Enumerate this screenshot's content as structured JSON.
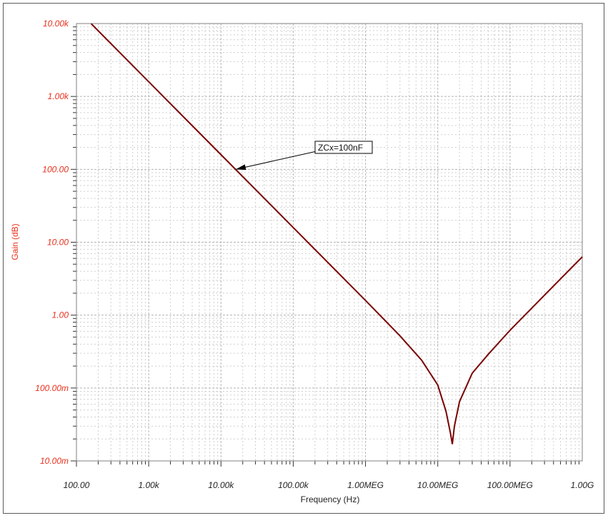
{
  "chart_data": {
    "type": "line",
    "xlabel": "Frequency (Hz)",
    "ylabel": "Gain (dB)",
    "x_scale": "log",
    "y_scale": "log",
    "xlim": [
      100,
      1000000000
    ],
    "ylim": [
      0.01,
      10000
    ],
    "grid": true,
    "x_tick_values": [
      100,
      1000,
      10000,
      100000,
      1000000,
      10000000,
      100000000,
      1000000000
    ],
    "x_tick_labels": [
      "100.00",
      "1.00k",
      "10.00k",
      "100.00k",
      "1.00MEG",
      "10.00MEG",
      "100.00MEG",
      "1.00G"
    ],
    "y_tick_values": [
      10000,
      1000,
      100,
      10,
      1,
      0.1,
      0.01
    ],
    "y_tick_labels": [
      "10.00k",
      "1.00k",
      "100.00",
      "10.00",
      "1.00",
      "100.00m",
      "10.00m"
    ],
    "series": [
      {
        "name": "ZCx=100nF",
        "color": "#7a0000",
        "x": [
          160,
          1000,
          10000,
          100000,
          1000000,
          3000000,
          6000000,
          10000000,
          13000000,
          15000000,
          15900000,
          17000000,
          20000000,
          30000000,
          50000000,
          100000000,
          300000000,
          1000000000
        ],
        "y": [
          9950,
          1590,
          159,
          15.9,
          1.59,
          0.52,
          0.24,
          0.11,
          0.048,
          0.024,
          0.017,
          0.03,
          0.065,
          0.16,
          0.29,
          0.62,
          1.88,
          6.3
        ]
      }
    ],
    "annotations": [
      {
        "text": "ZCx=100nF",
        "x": 16000,
        "y": 100
      }
    ]
  }
}
